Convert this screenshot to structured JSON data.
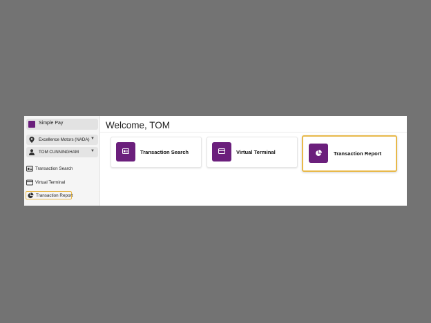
{
  "brand": {
    "label": "Simple Pay"
  },
  "selectors": {
    "location": "Excellence Motors (NADA)",
    "user": "TOM CUNNINGHAM"
  },
  "sidebar": {
    "items": [
      {
        "label": "Transaction Search",
        "icon": "id-card-icon"
      },
      {
        "label": "Virtual Terminal",
        "icon": "credit-card-icon"
      },
      {
        "label": "Transaction Report",
        "icon": "pie-chart-icon",
        "highlighted": true
      }
    ]
  },
  "main": {
    "welcome": "Welcome, TOM",
    "cards": [
      {
        "label": "Transaction Search",
        "icon": "id-card-icon"
      },
      {
        "label": "Virtual Terminal",
        "icon": "credit-card-icon"
      },
      {
        "label": "Transaction Report",
        "icon": "pie-chart-icon",
        "highlighted": true
      }
    ]
  },
  "colors": {
    "accent": "#6b1f7c",
    "highlight": "#e8b94a",
    "backdrop": "#737373"
  }
}
